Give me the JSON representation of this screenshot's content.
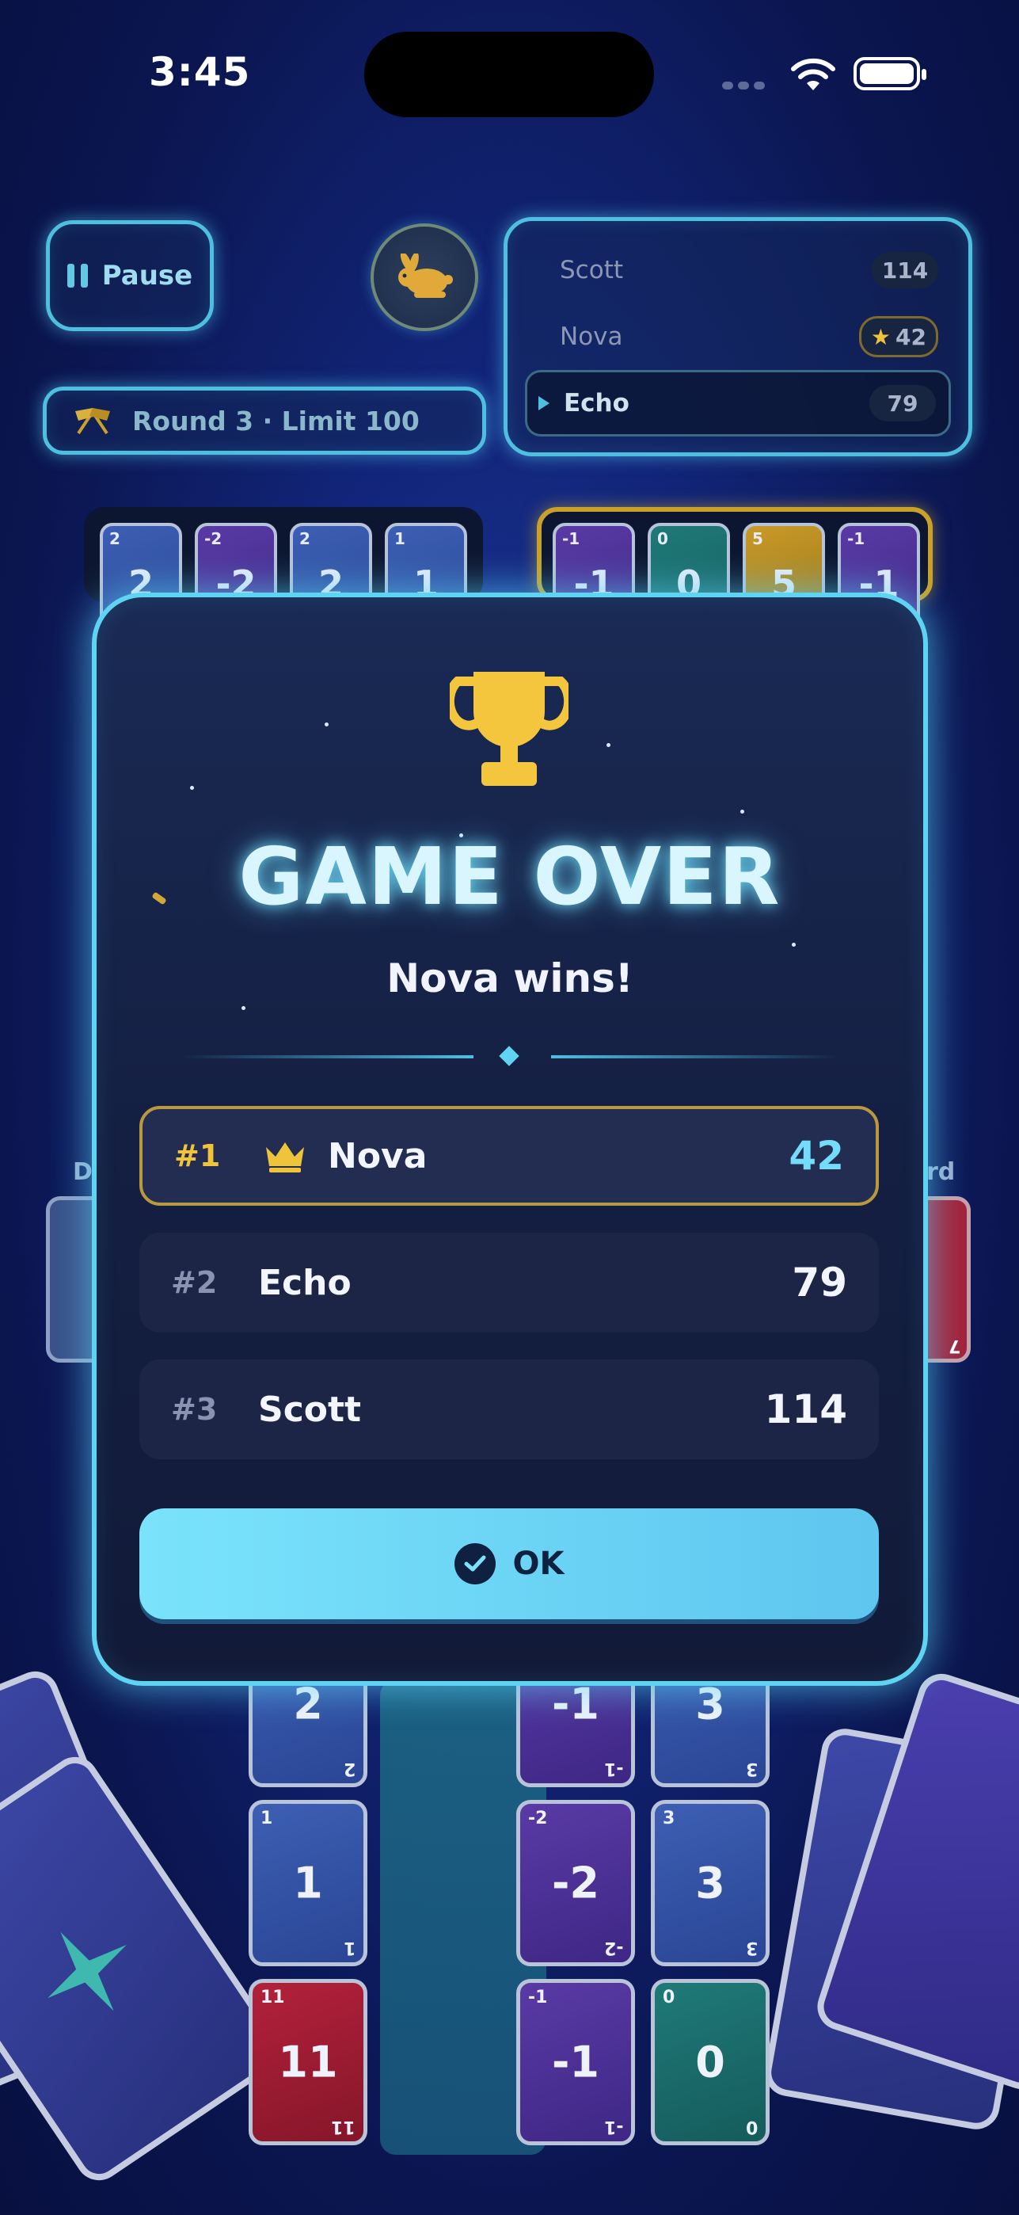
{
  "status_bar": {
    "time": "3:45"
  },
  "hud": {
    "pause_label": "Pause",
    "speed_icon": "rabbit-icon",
    "round_label": "Round 3 · Limit 100",
    "scoreboard": [
      {
        "name": "Scott",
        "score": "114",
        "starred": false,
        "active": false
      },
      {
        "name": "Nova",
        "score": "42",
        "starred": true,
        "active": false
      },
      {
        "name": "Echo",
        "score": "79",
        "starred": false,
        "active": true
      }
    ]
  },
  "board": {
    "top_left_hand": [
      {
        "value": "2",
        "color": "blue"
      },
      {
        "value": "-2",
        "color": "purple"
      },
      {
        "value": "2",
        "color": "blue"
      },
      {
        "value": "1",
        "color": "blue"
      }
    ],
    "top_right_hand": [
      {
        "value": "-1",
        "color": "purple"
      },
      {
        "value": "0",
        "color": "teal"
      },
      {
        "value": "5",
        "color": "yellow"
      },
      {
        "value": "-1",
        "color": "purple"
      }
    ],
    "bottom_left_column": [
      {
        "value": "2",
        "color": "blue"
      },
      {
        "value": "1",
        "color": "blue"
      },
      {
        "value": "11",
        "color": "red"
      }
    ],
    "bottom_mid_column": [
      {
        "value": "-1",
        "color": "purple"
      },
      {
        "value": "-2",
        "color": "purple"
      },
      {
        "value": "-1",
        "color": "purple"
      }
    ],
    "bottom_right_column": [
      {
        "value": "3",
        "color": "blue"
      },
      {
        "value": "3",
        "color": "blue"
      },
      {
        "value": "0",
        "color": "teal"
      }
    ],
    "deck_left_label": "D",
    "discard_right_label": "rd",
    "discard_right_card": "7"
  },
  "modal": {
    "title": "GAME OVER",
    "subtitle": "Nova wins!",
    "rankings": [
      {
        "rank": "#1",
        "name": "Nova",
        "score": "42",
        "crown": true
      },
      {
        "rank": "#2",
        "name": "Echo",
        "score": "79",
        "crown": false
      },
      {
        "rank": "#3",
        "name": "Scott",
        "score": "114",
        "crown": false
      }
    ],
    "ok_label": "OK"
  },
  "colors": {
    "accent": "#5ed3f2",
    "gold": "#f0c43a",
    "button": "#6fd6f7"
  }
}
